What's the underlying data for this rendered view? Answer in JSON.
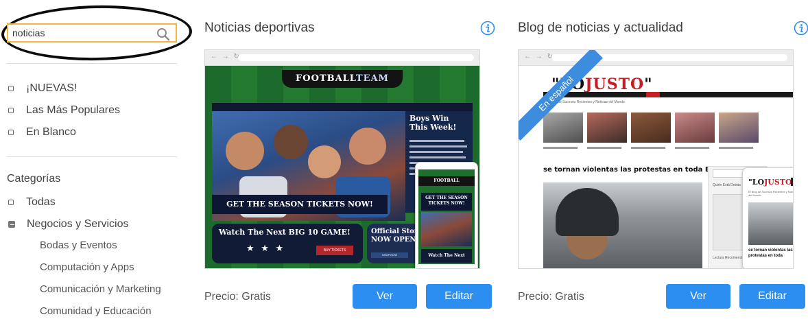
{
  "search": {
    "value": "noticias",
    "placeholder": ""
  },
  "filters": [
    {
      "label": "¡NUEVAS!"
    },
    {
      "label": "Las Más Populares"
    },
    {
      "label": "En Blanco"
    }
  ],
  "categories": {
    "heading": "Categorías",
    "items": [
      {
        "label": "Todas"
      },
      {
        "label": "Negocios y Servicios"
      }
    ],
    "subitems": [
      {
        "label": "Bodas y Eventos"
      },
      {
        "label": "Computación y Apps"
      },
      {
        "label": "Comunicación y Marketing"
      },
      {
        "label": "Comunidad y Educación"
      }
    ]
  },
  "templates": [
    {
      "title": "Noticias deportivas",
      "price": "Precio: Gratis",
      "view_label": "Ver",
      "edit_label": "Editar",
      "preview": {
        "logo_main": "FOOTBALL",
        "logo_accent": "TEAM",
        "side_heading": "Boys Win This Week!",
        "tickets": "GET THE SEASON TICKETS NOW!",
        "game_banner": "Watch The Next BIG 10 GAME!",
        "store_banner": "Official Store NOW OPEN!",
        "buy_tickets": "BUY TICKETS",
        "shop_now": "SHOP NOW",
        "mobile_tickets": "GET THE SEASON TICKETS NOW!",
        "mobile_watch": "Watch The Next"
      }
    },
    {
      "title": "Blog de noticias y actualidad",
      "price": "Precio: Gratis",
      "view_label": "Ver",
      "edit_label": "Editar",
      "preview": {
        "ribbon": "En español",
        "logo_quote_open": "\"LO",
        "logo_accent": "JUSTO",
        "logo_quote_close": "\"",
        "tagline": "El Blog de Sucesos Recientes y Noticias del Mundo",
        "headline": "se tornan violentas las protestas en toda Europa",
        "side_label": "Quién Está Detrás",
        "side_footer": "Lectura Recomendada",
        "mobile_headline": "se tornan violentas las protestas en toda"
      }
    }
  ],
  "colors": {
    "accent": "#2b8ef0",
    "search_border": "#f0b53a",
    "annotation_circle": "#0c0c0c",
    "ribbon": "#3d8cde",
    "brand_red": "#c32025"
  },
  "icons": {
    "search": "search-icon",
    "info": "info-icon",
    "checkbox": "checkbox-icon"
  }
}
